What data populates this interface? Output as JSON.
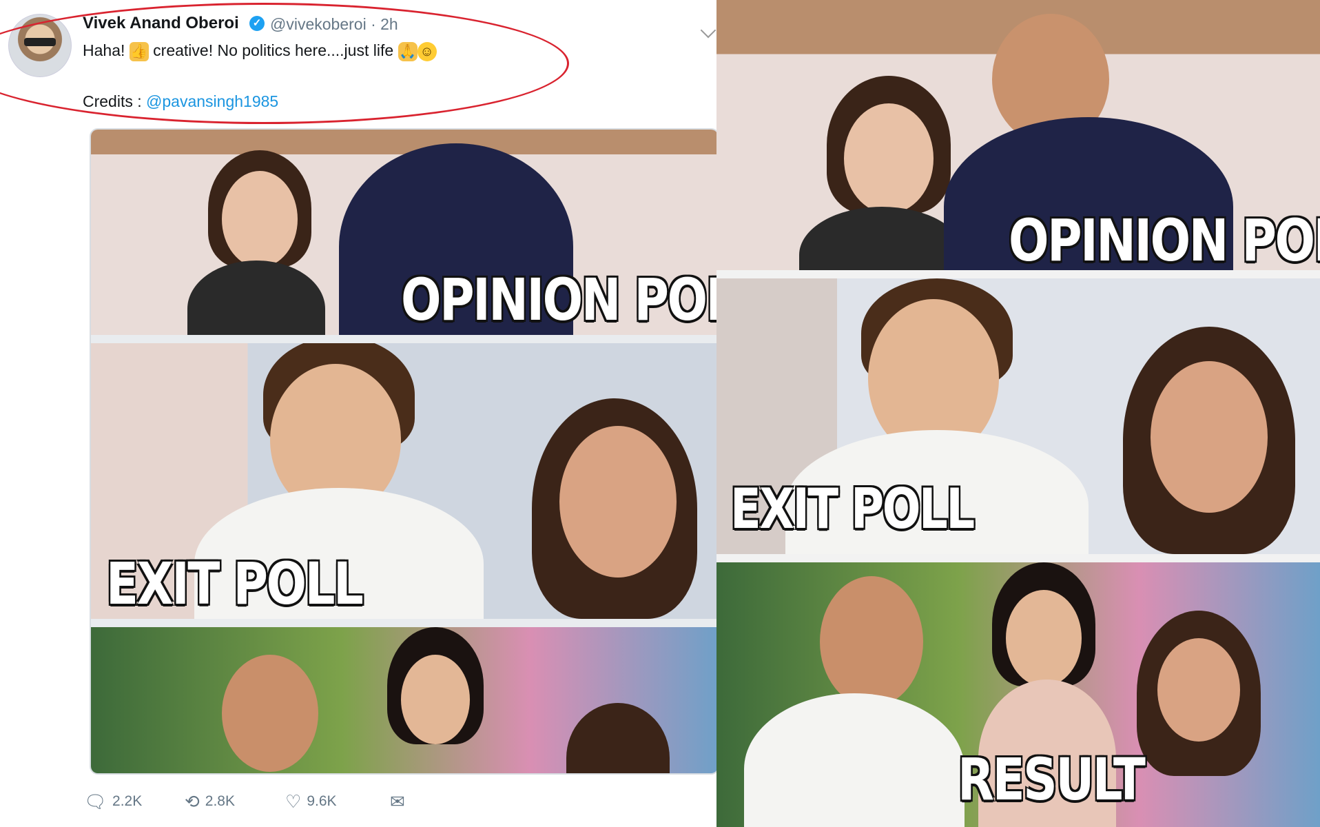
{
  "tweet": {
    "author_name": "Vivek Anand Oberoi",
    "verified_mark": "✓",
    "handle_time": "@vivekoberoi · 2h",
    "text_parts": [
      "Haha! ",
      " creative! No politics here....just life "
    ],
    "emoji": {
      "thumbs_up": "👍",
      "pray": "🙏",
      "smile": "☺"
    },
    "credits_label": "Credits : ",
    "credits_mention": "@pavansingh1985",
    "actions": {
      "replies": "2.2K",
      "retweets": "2.8K",
      "likes": "9.6K"
    },
    "icons": {
      "reply": "speech-bubble",
      "retweet": "retweet-arrows",
      "like": "heart",
      "dm": "envelope"
    },
    "highlight_color": "#d9232f"
  },
  "meme_captions": {
    "opinion": "OPINION POLL",
    "exit": "EXIT POLL",
    "result": "RESULT"
  }
}
